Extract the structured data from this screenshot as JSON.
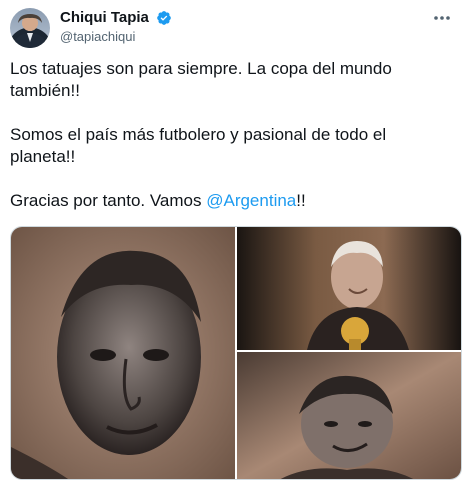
{
  "tweet": {
    "author": {
      "display_name": "Chiqui Tapia",
      "handle": "@tapiachiqui",
      "verified": true
    },
    "text_lines": {
      "p1": "Los tatuajes son para siempre. La copa del mundo también!!",
      "p2": "Somos el país más futbolero y pasional de todo el planeta!!",
      "p3_before": "Gracias por tanto. Vamos ",
      "p3_mention": "@Argentina",
      "p3_after": "!!"
    },
    "media": [
      {
        "description_icon": "tattoo-portrait-photo"
      },
      {
        "description_icon": "tattoo-portrait-with-trophy-photo"
      },
      {
        "description_icon": "tattoo-portrait-smiling-photo"
      }
    ]
  },
  "colors": {
    "accent": "#1d9bf0",
    "text": "#0f1419",
    "muted": "#536471"
  },
  "icons": {
    "verified": "verified-badge-icon",
    "more": "more-options-icon"
  }
}
